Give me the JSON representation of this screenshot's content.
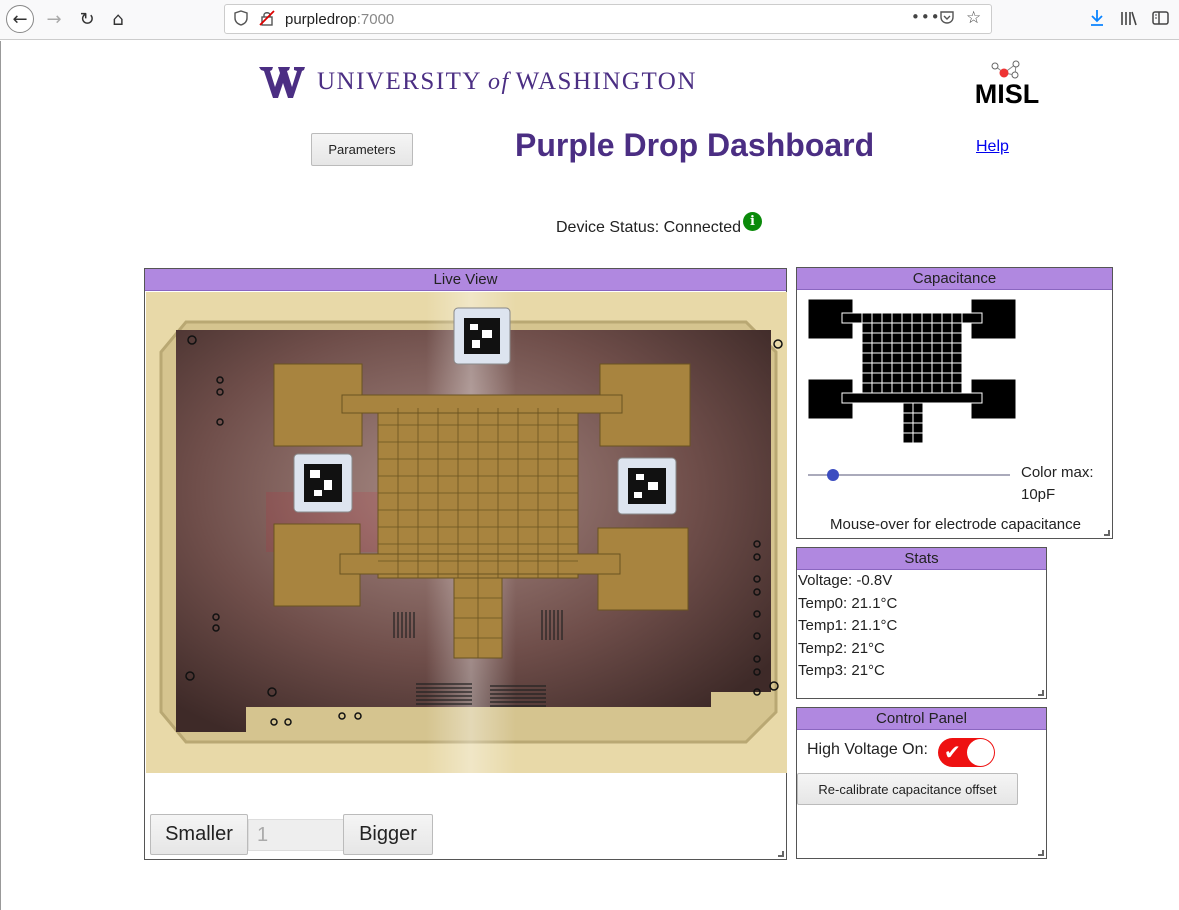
{
  "browser": {
    "url_host": "purpledrop",
    "url_port": ":7000",
    "icons": [
      "back-icon",
      "forward-icon",
      "reload-icon",
      "home-icon",
      "shield-icon",
      "insecure-lock-icon",
      "more-icon",
      "pocket-icon",
      "star-icon",
      "download-icon",
      "library-icon",
      "sidebar-icon"
    ]
  },
  "header": {
    "org_name_pre": "UNIVERSITY",
    "org_name_of": "of",
    "org_name_post": "WASHINGTON",
    "lab_logo_text": "MISL",
    "title": "Purple Drop Dashboard",
    "parameters_label": "Parameters",
    "help_label": "Help"
  },
  "status": {
    "label": "Device Status: Connected",
    "info_icon": "i"
  },
  "live_view": {
    "title": "Live View",
    "smaller_label": "Smaller",
    "scale_value": "1",
    "bigger_label": "Bigger"
  },
  "capacitance": {
    "title": "Capacitance",
    "color_max_label": "Color max:",
    "color_max_value": "10pF",
    "slider_value": 0.1,
    "hint": "Mouse-over for electrode capacitance"
  },
  "stats": {
    "title": "Stats",
    "rows": [
      "Voltage: -0.8V",
      "Temp0: 21.1°C",
      "Temp1: 21.1°C",
      "Temp2: 21°C",
      "Temp3: 21°C"
    ]
  },
  "control_panel": {
    "title": "Control Panel",
    "hv_label": "High Voltage On:",
    "hv_on": true,
    "recal_label": "Re-calibrate capacitance offset"
  },
  "colors": {
    "brand_purple": "#4b2e83",
    "panel_header": "#b088e0",
    "toggle_on": "#ee1111",
    "status_ok": "#0a8a0a"
  }
}
